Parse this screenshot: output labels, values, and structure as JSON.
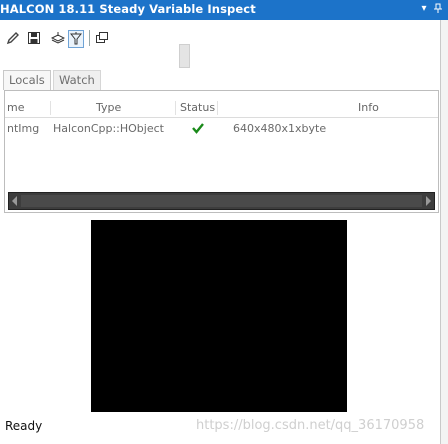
{
  "window": {
    "title": "HALCON 18.11 Steady Variable Inspect",
    "controls": [
      "dropdown-arrow",
      "pin"
    ]
  },
  "toolbar": {
    "buttons": [
      {
        "icon": "pencil-icon"
      },
      {
        "icon": "save-icon"
      },
      {
        "icon": "layers-icon"
      },
      {
        "icon": "filter-icon",
        "active": true
      },
      {
        "icon": "window-icon"
      }
    ]
  },
  "tabs": [
    "Locals",
    "Watch"
  ],
  "table": {
    "columns": [
      "me",
      "Type",
      "Status",
      "Info"
    ],
    "rows": [
      {
        "name": "ntImg",
        "type": "HalconCpp::HObject",
        "status": "ok",
        "info": "640x480x1xbyte"
      }
    ]
  },
  "image_view": {
    "fill": "#000000"
  },
  "status_bar": {
    "text": "Ready"
  },
  "watermark": {
    "text": "https://blog.csdn.net/qq_36170958"
  },
  "colors": {
    "title_bar": "#1c73c9",
    "check": "#1a8a1a"
  }
}
